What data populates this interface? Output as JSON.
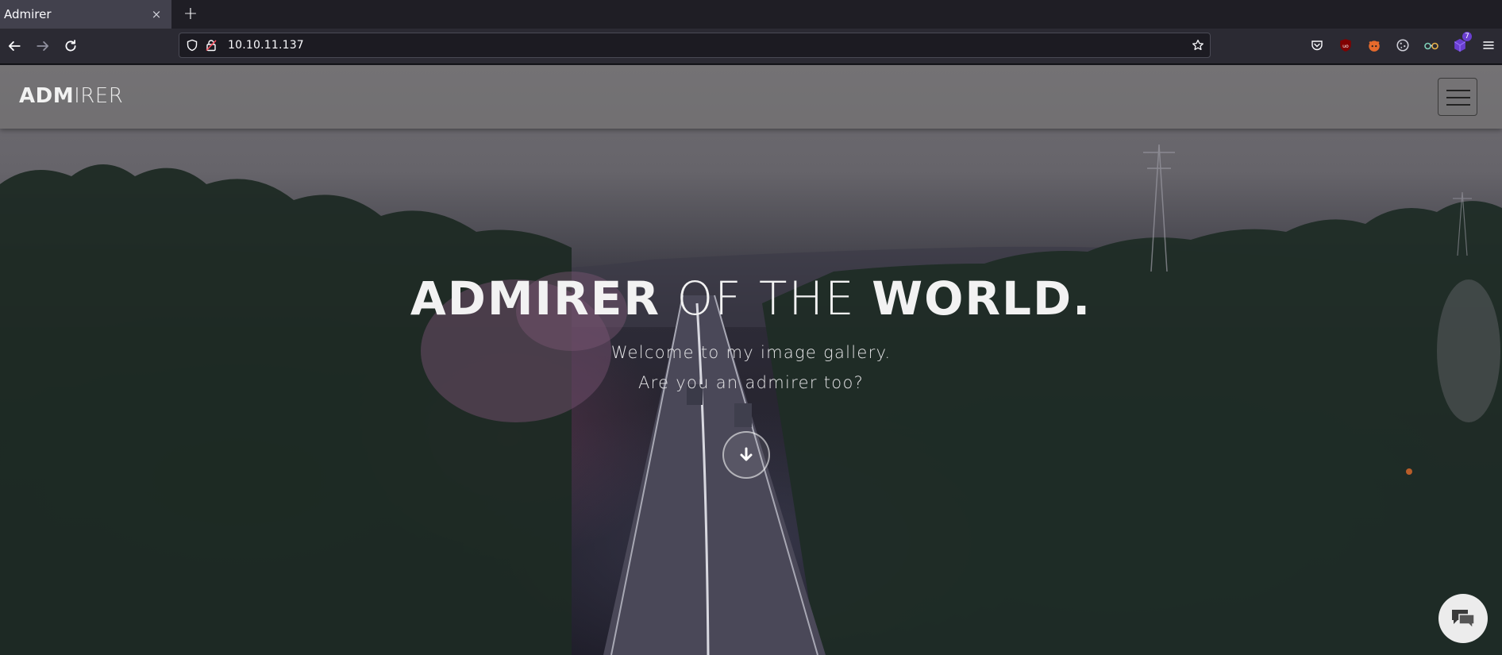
{
  "browser": {
    "tab": {
      "title": "Admirer",
      "close_glyph": "×"
    },
    "new_tab_glyph": "+",
    "url": "10.10.11.137",
    "extension_badge": "7"
  },
  "site": {
    "logo_bold": "ADM",
    "logo_light": "IRER"
  },
  "hero": {
    "title_bold": "ADMIRER",
    "title_light": " OF THE ",
    "title_bold2": "WORLD.",
    "subtitle": "Welcome to my image gallery.",
    "subtitle2": "Are you an admirer too?"
  },
  "colors": {
    "chrome_bg": "#2b2a33",
    "tab_active": "#42414d",
    "header_overlay": "#787676",
    "text": "#f2f2f2"
  },
  "icons": {
    "back": "back-arrow-icon",
    "forward": "forward-arrow-icon",
    "reload": "reload-icon",
    "shield": "tracking-shield-icon",
    "lock": "insecure-lock-icon",
    "bookmark": "star-icon",
    "pocket": "pocket-icon",
    "ublock": "ublock-icon",
    "foxyproxy": "foxyproxy-icon",
    "settings_ext": "cookie-icon",
    "glasses": "glasses-icon",
    "cube": "cube-extension-icon",
    "menu": "hamburger-menu-icon",
    "scroll_down": "arrow-down-icon",
    "chat": "chat-bubbles-icon"
  }
}
